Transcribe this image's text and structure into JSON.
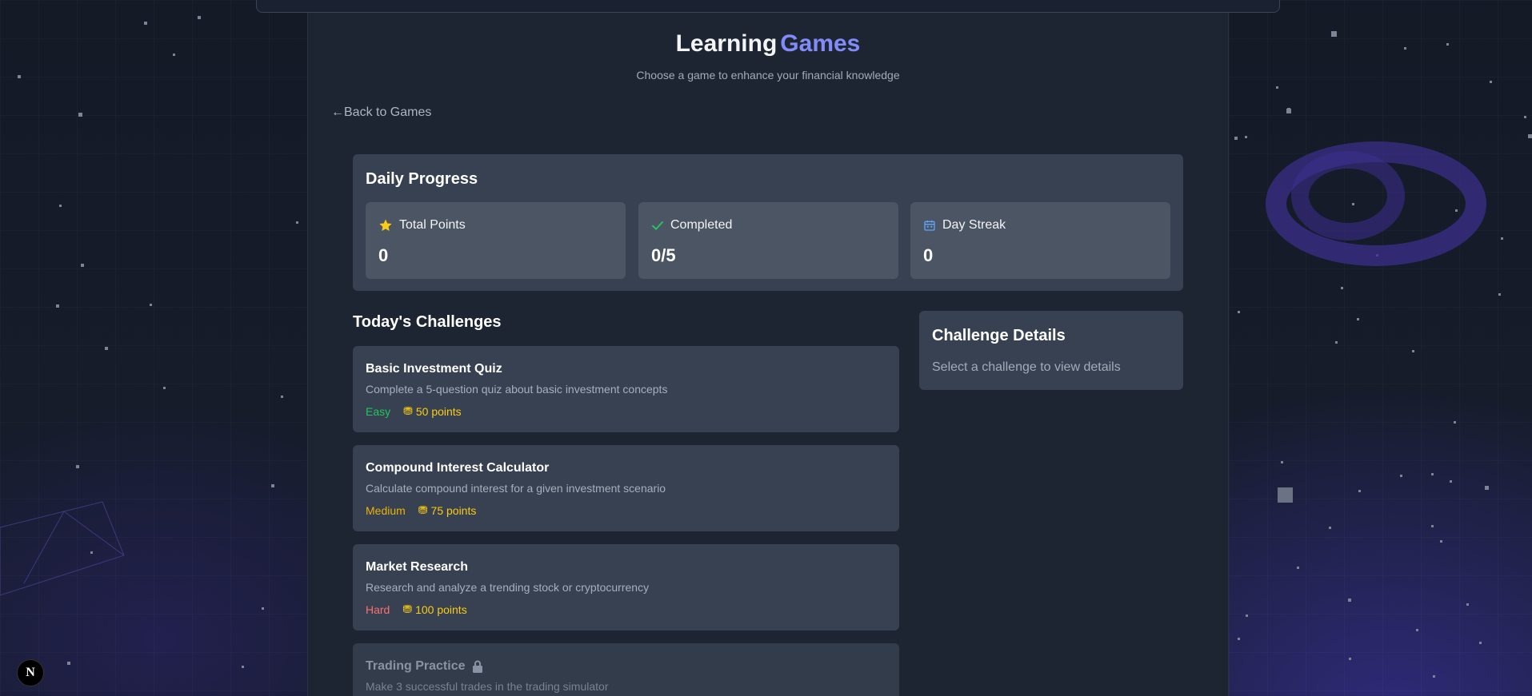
{
  "header": {
    "title_part1": "Learning",
    "title_part2": "Games",
    "subtitle": "Choose a game to enhance your financial knowledge",
    "back_label": "Back to Games",
    "back_arrow": "←"
  },
  "progress": {
    "title": "Daily Progress",
    "stats": [
      {
        "label": "Total Points",
        "value": "0",
        "icon": "star-icon"
      },
      {
        "label": "Completed",
        "value": "0/5",
        "icon": "check-icon"
      },
      {
        "label": "Day Streak",
        "value": "0",
        "icon": "calendar-icon"
      }
    ]
  },
  "challenges": {
    "title": "Today's Challenges",
    "items": [
      {
        "name": "Basic Investment Quiz",
        "description": "Complete a 5-question quiz about basic investment concepts",
        "difficulty": "Easy",
        "points": "50 points"
      },
      {
        "name": "Compound Interest Calculator",
        "description": "Calculate compound interest for a given investment scenario",
        "difficulty": "Medium",
        "points": "75 points"
      },
      {
        "name": "Market Research",
        "description": "Research and analyze a trending stock or cryptocurrency",
        "difficulty": "Hard",
        "points": "100 points"
      },
      {
        "name": "Trading Practice",
        "description": "Make 3 successful trades in the trading simulator",
        "locked": true
      }
    ]
  },
  "details": {
    "title": "Challenge Details",
    "placeholder": "Select a challenge to view details"
  },
  "badge": {
    "letter": "N"
  },
  "colors": {
    "accent": "#818cf8",
    "easy": "#22c55e",
    "medium": "#eab308",
    "hard": "#f87171",
    "points": "#facc15",
    "card": "#374151"
  }
}
